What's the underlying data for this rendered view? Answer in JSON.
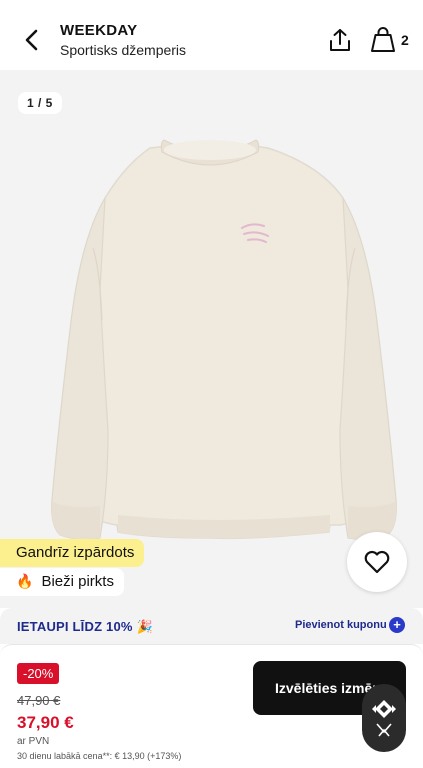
{
  "header": {
    "brand": "WEEKDAY",
    "product_name": "Sportisks džemperis",
    "bag_count": "2"
  },
  "gallery": {
    "counter": "1 / 5"
  },
  "badges": {
    "almost_sold_out": "Gandrīz izpārdots",
    "often_bought": "Bieži pirkts",
    "often_bought_icon": "fire-icon"
  },
  "coupon": {
    "text": "IETAUPI LĪDZ 10% 🎉",
    "link": "Pievienot kuponu",
    "plus": "+"
  },
  "price": {
    "discount": "-20%",
    "old_price": "47,90 €",
    "new_price": "37,90 €",
    "vat": "ar PVN",
    "lowest_price": "30 dienu labākā cena**: € 13,90 (+173%)"
  },
  "actions": {
    "choose_size": "Izvēlēties izmēru"
  },
  "colors": {
    "accent_red": "#d8102a",
    "coupon_blue": "#1e2a8c",
    "badge_yellow": "#fbef8e"
  }
}
